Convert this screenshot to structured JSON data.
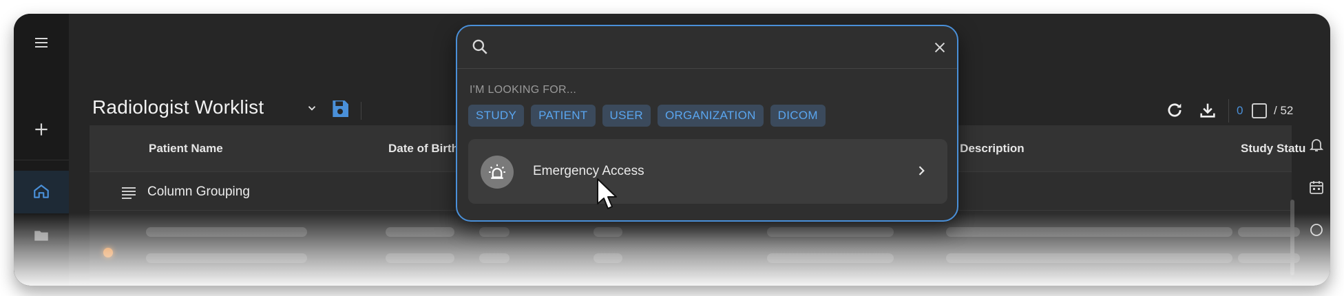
{
  "header": {
    "title": "Radiologist Worklist"
  },
  "selection": {
    "selected_count": "0",
    "total": "/ 52"
  },
  "table": {
    "columns": [
      {
        "label": "Patient Name"
      },
      {
        "label": "Date of Birth"
      },
      {
        "label": "y Description"
      },
      {
        "label": "Study Statu"
      }
    ],
    "grouping_label": "Column Grouping"
  },
  "search": {
    "placeholder": "",
    "looking_for_label": "I'M LOOKING FOR...",
    "chips": [
      "STUDY",
      "PATIENT",
      "USER",
      "ORGANIZATION",
      "DICOM"
    ],
    "results": [
      {
        "label": "Emergency Access",
        "icon": "siren-icon"
      }
    ]
  },
  "icons": {
    "left_rail": [
      "menu-icon",
      "plus-icon",
      "home-icon",
      "folder-icon"
    ],
    "right_rail": [
      "bell-icon",
      "calendar-icon",
      "chat-icon"
    ],
    "toolbar": [
      "refresh-icon",
      "download-icon",
      "save-icon",
      "chevron-down-icon"
    ]
  },
  "colors": {
    "accent": "#4a90d9",
    "chip_bg": "#3b4a5c",
    "chip_text": "#5aa6f0",
    "background": "#262626",
    "warning_dot": "#e07a1f"
  }
}
